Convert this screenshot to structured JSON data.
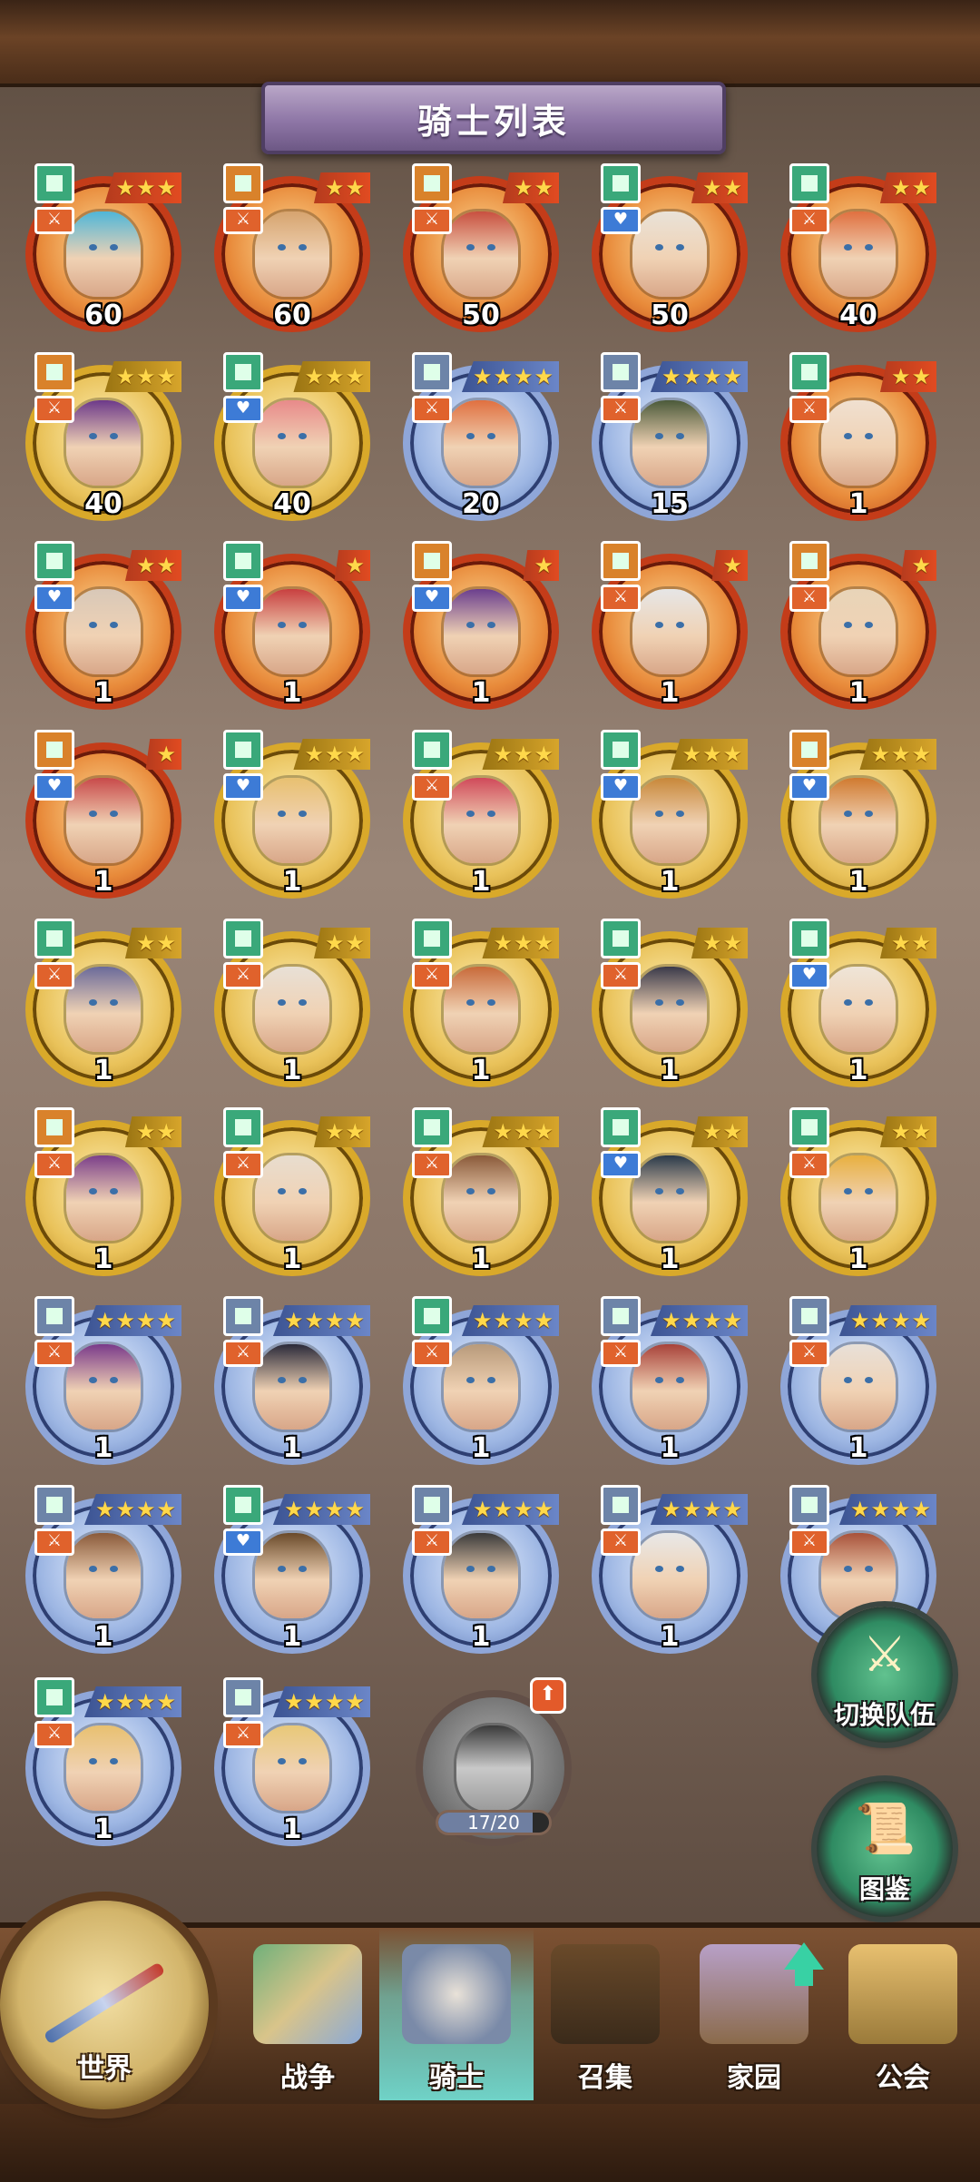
{
  "title": "骑士列表",
  "knights": [
    {
      "level": "60",
      "stars": 3,
      "frame": "red",
      "cls": "green",
      "role": "orange",
      "portrait": "#4fb6d8"
    },
    {
      "level": "60",
      "stars": 2,
      "frame": "red",
      "cls": "orange",
      "role": "orange",
      "portrait": "#d6a46f"
    },
    {
      "level": "50",
      "stars": 2,
      "frame": "red",
      "cls": "orange",
      "role": "orange",
      "portrait": "#c85040"
    },
    {
      "level": "50",
      "stars": 2,
      "frame": "red",
      "cls": "green",
      "role": "blue",
      "portrait": "#e9e2d8"
    },
    {
      "level": "40",
      "stars": 2,
      "frame": "red",
      "cls": "green",
      "role": "orange",
      "portrait": "#e07040"
    },
    {
      "level": "40",
      "stars": 3,
      "frame": "gold",
      "cls": "orange",
      "role": "orange",
      "portrait": "#6d3a8a"
    },
    {
      "level": "40",
      "stars": 3,
      "frame": "gold",
      "cls": "green",
      "role": "blue",
      "portrait": "#e88a8a"
    },
    {
      "level": "20",
      "stars": 4,
      "frame": "blue",
      "cls": "slate",
      "role": "orange",
      "portrait": "#e07040"
    },
    {
      "level": "15",
      "stars": 4,
      "frame": "blue",
      "cls": "slate",
      "role": "orange",
      "portrait": "#4b5a3a"
    },
    {
      "level": "1",
      "stars": 2,
      "frame": "red",
      "cls": "green",
      "role": "orange",
      "portrait": "#f0e0d0"
    },
    {
      "level": "1",
      "stars": 2,
      "frame": "red",
      "cls": "green",
      "role": "blue",
      "portrait": "#d8c8b8"
    },
    {
      "level": "1",
      "stars": 1,
      "frame": "red",
      "cls": "green",
      "role": "blue",
      "portrait": "#c84040"
    },
    {
      "level": "1",
      "stars": 1,
      "frame": "red",
      "cls": "orange",
      "role": "blue",
      "portrait": "#6b3f8e"
    },
    {
      "level": "1",
      "stars": 1,
      "frame": "red",
      "cls": "orange",
      "role": "orange",
      "portrait": "#e6e6e6"
    },
    {
      "level": "1",
      "stars": 1,
      "frame": "red",
      "cls": "orange",
      "role": "orange",
      "portrait": "#e8d4b8"
    },
    {
      "level": "1",
      "stars": 1,
      "frame": "red",
      "cls": "orange",
      "role": "blue",
      "portrait": "#c84a4a"
    },
    {
      "level": "1",
      "stars": 3,
      "frame": "gold",
      "cls": "green",
      "role": "blue",
      "portrait": "#e8c070"
    },
    {
      "level": "1",
      "stars": 3,
      "frame": "gold",
      "cls": "green",
      "role": "orange",
      "portrait": "#d04a5a"
    },
    {
      "level": "1",
      "stars": 3,
      "frame": "gold",
      "cls": "green",
      "role": "blue",
      "portrait": "#c8883a"
    },
    {
      "level": "1",
      "stars": 3,
      "frame": "gold",
      "cls": "orange",
      "role": "blue",
      "portrait": "#d07a30"
    },
    {
      "level": "1",
      "stars": 2,
      "frame": "gold",
      "cls": "green",
      "role": "orange",
      "portrait": "#6a6a9a"
    },
    {
      "level": "1",
      "stars": 2,
      "frame": "gold",
      "cls": "green",
      "role": "orange",
      "portrait": "#e8e0d6"
    },
    {
      "level": "1",
      "stars": 3,
      "frame": "gold",
      "cls": "green",
      "role": "orange",
      "portrait": "#c86a3a"
    },
    {
      "level": "1",
      "stars": 2,
      "frame": "gold",
      "cls": "green",
      "role": "orange",
      "portrait": "#3a3a4a"
    },
    {
      "level": "1",
      "stars": 2,
      "frame": "gold",
      "cls": "green",
      "role": "blue",
      "portrait": "#efe5d8"
    },
    {
      "level": "1",
      "stars": 2,
      "frame": "gold",
      "cls": "orange",
      "role": "orange",
      "portrait": "#7b3f8a"
    },
    {
      "level": "1",
      "stars": 2,
      "frame": "gold",
      "cls": "green",
      "role": "orange",
      "portrait": "#e8ddcf"
    },
    {
      "level": "1",
      "stars": 3,
      "frame": "gold",
      "cls": "green",
      "role": "orange",
      "portrait": "#8a5a3a"
    },
    {
      "level": "1",
      "stars": 2,
      "frame": "gold",
      "cls": "green",
      "role": "blue",
      "portrait": "#2a3a4a"
    },
    {
      "level": "1",
      "stars": 2,
      "frame": "gold",
      "cls": "green",
      "role": "orange",
      "portrait": "#e8b040"
    },
    {
      "level": "1",
      "stars": 4,
      "frame": "blue",
      "cls": "slate",
      "role": "orange",
      "portrait": "#7a3a8a"
    },
    {
      "level": "1",
      "stars": 4,
      "frame": "blue",
      "cls": "slate",
      "role": "orange",
      "portrait": "#2a2a3a"
    },
    {
      "level": "1",
      "stars": 4,
      "frame": "blue",
      "cls": "green",
      "role": "orange",
      "portrait": "#b89a7a"
    },
    {
      "level": "1",
      "stars": 4,
      "frame": "blue",
      "cls": "slate",
      "role": "orange",
      "portrait": "#a8423a"
    },
    {
      "level": "1",
      "stars": 4,
      "frame": "blue",
      "cls": "slate",
      "role": "orange",
      "portrait": "#e8e0d8"
    },
    {
      "level": "1",
      "stars": 4,
      "frame": "blue",
      "cls": "slate",
      "role": "orange",
      "portrait": "#8a5a3a"
    },
    {
      "level": "1",
      "stars": 4,
      "frame": "blue",
      "cls": "green",
      "role": "blue",
      "portrait": "#6a4a2a"
    },
    {
      "level": "1",
      "stars": 4,
      "frame": "blue",
      "cls": "slate",
      "role": "orange",
      "portrait": "#3a3a3a"
    },
    {
      "level": "1",
      "stars": 4,
      "frame": "blue",
      "cls": "slate",
      "role": "orange",
      "portrait": "#e8e8e8"
    },
    {
      "level": "1",
      "stars": 4,
      "frame": "blue",
      "cls": "slate",
      "role": "orange",
      "portrait": "#a8523a"
    },
    {
      "level": "1",
      "stars": 4,
      "frame": "blue",
      "cls": "green",
      "role": "orange",
      "portrait": "#e8c070"
    },
    {
      "level": "1",
      "stars": 4,
      "frame": "blue",
      "cls": "slate",
      "role": "orange",
      "portrait": "#e8c878"
    }
  ],
  "locked_knight": {
    "progress": "17/20",
    "progress_value": 0.85
  },
  "side_buttons": {
    "switch_team": "切换队伍",
    "codex": "图鉴"
  },
  "nav": {
    "world": "世界",
    "war": "战争",
    "knight": "骑士",
    "summon": "召集",
    "home": "家园",
    "guild": "公会"
  }
}
